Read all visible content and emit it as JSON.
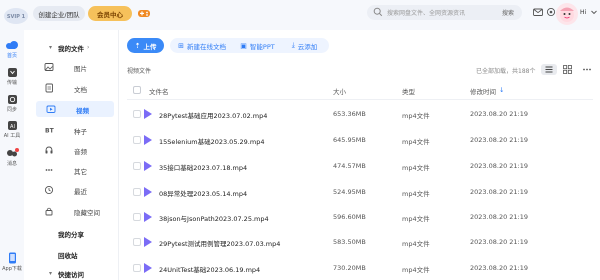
{
  "header": {
    "logo_text": "SVIP 1",
    "team_label": "创建企业/团队",
    "member_label": "会员中心",
    "search_placeholder": "搜索网盘文件、全网资源资讯",
    "search_button": "搜索",
    "greeting": "Hi"
  },
  "rail": {
    "items": [
      {
        "label": "首页",
        "icon": "cloud-icon"
      },
      {
        "label": "传输",
        "icon": "transfer-icon"
      },
      {
        "label": "同步",
        "icon": "sync-icon"
      },
      {
        "label": "AI 工具",
        "icon": "ai-icon"
      },
      {
        "label": "消息",
        "icon": "message-icon"
      },
      {
        "label": "App下载",
        "icon": "phone-icon"
      }
    ]
  },
  "sidebar": {
    "my_files": "我的文件",
    "items": [
      {
        "label": "图片",
        "icon": "image-icon"
      },
      {
        "label": "文档",
        "icon": "document-icon"
      },
      {
        "label": "视频",
        "icon": "video-icon"
      },
      {
        "label": "种子",
        "icon": "torrent-icon"
      },
      {
        "label": "音频",
        "icon": "audio-icon"
      },
      {
        "label": "其它",
        "icon": "more-icon"
      },
      {
        "label": "最近",
        "icon": "clock-icon"
      },
      {
        "label": "隐藏空间",
        "icon": "lock-icon"
      }
    ],
    "my_share": "我的分享",
    "recycle": "回收站",
    "quick_access": "快捷访问"
  },
  "toolbar": {
    "upload": "上传",
    "new_doc": "新建在线文档",
    "smart_ppt": "智能PPT",
    "cloud_add": "云添加"
  },
  "list": {
    "breadcrumb": "视频文件",
    "count": "已全部加载，共188个",
    "columns": {
      "name": "文件名",
      "size": "大小",
      "type": "类型",
      "modified": "修改时间"
    },
    "rows": [
      {
        "name": "28Pytest基础应用2023.07.02.mp4",
        "size": "653.36MB",
        "type": "mp4文件",
        "time": "2023.08.20 21:19"
      },
      {
        "name": "15Selenium基础2023.05.29.mp4",
        "size": "645.95MB",
        "type": "mp4文件",
        "time": "2023.08.20 21:19"
      },
      {
        "name": "35接口基础2023.07.18.mp4",
        "size": "474.57MB",
        "type": "mp4文件",
        "time": "2023.08.20 21:19"
      },
      {
        "name": "08异常处理2023.05.14.mp4",
        "size": "524.95MB",
        "type": "mp4文件",
        "time": "2023.08.20 21:19"
      },
      {
        "name": "38json与JsonPath2023.07.25.mp4",
        "size": "596.60MB",
        "type": "mp4文件",
        "time": "2023.08.20 21:19"
      },
      {
        "name": "29Pytest测试用例管理2023.07.03.mp4",
        "size": "583.50MB",
        "type": "mp4文件",
        "time": "2023.08.20 21:19"
      },
      {
        "name": "24UnitTest基础2023.06.19.mp4",
        "size": "730.20MB",
        "type": "mp4文件",
        "time": "2023.08.20 21:19"
      }
    ]
  },
  "colors": {
    "accent": "#2f7cf6",
    "video_icon": "#7b6cf6",
    "member_gold": "#f6c15b"
  }
}
